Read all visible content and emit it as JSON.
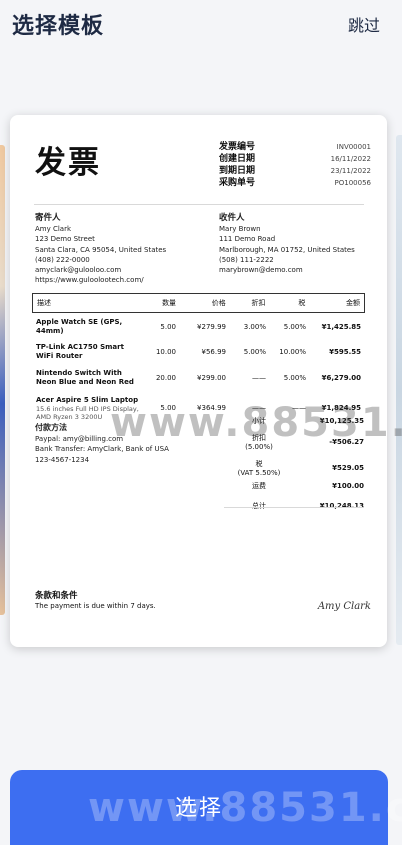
{
  "header": {
    "title": "选择模板",
    "skip_label": "跳过"
  },
  "invoice": {
    "title": "发票",
    "meta": [
      {
        "label": "发票编号",
        "value": "INV00001"
      },
      {
        "label": "创建日期",
        "value": "16/11/2022"
      },
      {
        "label": "到期日期",
        "value": "23/11/2022"
      },
      {
        "label": "采购单号",
        "value": "PO100056"
      }
    ],
    "from": {
      "heading": "寄件人",
      "lines": [
        "Amy Clark",
        "123 Demo Street",
        "Santa Clara, CA 95054, United States",
        "(408) 222-0000",
        "amyclark@gulooloo.com",
        "https://www.guloolootech.com/"
      ]
    },
    "to": {
      "heading": "收件人",
      "lines": [
        "Mary Brown",
        "111 Demo Road",
        "Marlborough, MA 01752, United States",
        "(508) 111-2222",
        "marybrown@demo.com"
      ]
    },
    "table": {
      "headers": {
        "desc": "描述",
        "qty": "数量",
        "price": "价格",
        "disc": "折扣",
        "tax": "税",
        "amt": "金额"
      },
      "rows": [
        {
          "desc": "Apple Watch SE (GPS, 44mm)",
          "sub": "",
          "qty": "5.00",
          "price": "¥279.99",
          "disc": "3.00%",
          "tax": "5.00%",
          "amt": "¥1,425.85"
        },
        {
          "desc": "TP-Link AC1750 Smart WiFi Router",
          "sub": "",
          "qty": "10.00",
          "price": "¥56.99",
          "disc": "5.00%",
          "tax": "10.00%",
          "amt": "¥595.55"
        },
        {
          "desc": "Nintendo Switch With Neon Blue and Neon Red",
          "sub": "",
          "qty": "20.00",
          "price": "¥299.00",
          "disc": "——",
          "tax": "5.00%",
          "amt": "¥6,279.00"
        },
        {
          "desc": "Acer Aspire 5 Slim Laptop",
          "sub": "15.6 inches Full HD IPS Display, AMD Ryzen 3 3200U",
          "qty": "5.00",
          "price": "¥364.99",
          "disc": "——",
          "tax": "——",
          "amt": "¥1,824.95"
        }
      ]
    },
    "payment": {
      "heading": "付款方法",
      "lines": [
        "Paypal: amy@billing.com",
        "Bank Transfer: AmyClark, Bank of USA",
        "123-4567-1234"
      ]
    },
    "totals": [
      {
        "label": "小计",
        "value": "¥10,125.35"
      },
      {
        "label": "折扣\n(5.00%)",
        "value": "-¥506.27"
      },
      {
        "label": "税\n(VAT 5.50%)",
        "value": "¥529.05"
      },
      {
        "label": "运费",
        "value": "¥100.00"
      },
      {
        "label": "总计",
        "value": "¥10,248.13"
      }
    ],
    "terms": {
      "heading": "条款和条件",
      "text": "The payment is due within 7 days."
    },
    "signature": "Amy Clark"
  },
  "watermark": "www.88531.cn",
  "watermark_short": "www.88531.cn",
  "select_label": "选择"
}
